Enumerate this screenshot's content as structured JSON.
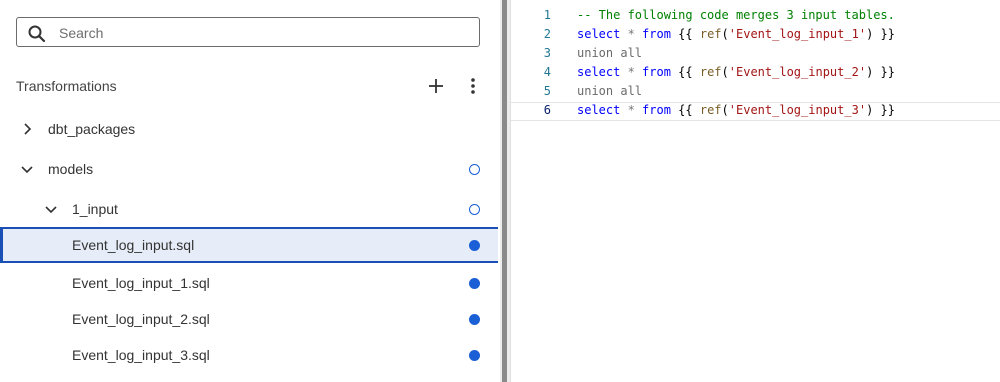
{
  "sidebar": {
    "search": {
      "placeholder": "Search"
    },
    "section_title": "Transformations",
    "add_icon": "plus-icon",
    "more_icon": "vertical-ellipsis-icon",
    "tree": [
      {
        "label": "dbt_packages",
        "expander": "chevron-right",
        "status": "none",
        "selected": false
      },
      {
        "label": "models",
        "expander": "chevron-down",
        "status": "open-circle",
        "selected": false
      },
      {
        "label": "1_input",
        "expander": "chevron-down",
        "status": "open-circle",
        "selected": false
      },
      {
        "label": "Event_log_input.sql",
        "expander": "none",
        "status": "filled-circle",
        "selected": true
      },
      {
        "label": "Event_log_input_1.sql",
        "expander": "none",
        "status": "filled-circle",
        "selected": false
      },
      {
        "label": "Event_log_input_2.sql",
        "expander": "none",
        "status": "filled-circle",
        "selected": false
      },
      {
        "label": "Event_log_input_3.sql",
        "expander": "none",
        "status": "filled-circle",
        "selected": false
      }
    ]
  },
  "editor": {
    "current_line": 6,
    "lines": [
      {
        "num": "1",
        "tokens": [
          {
            "t": "-- The following code merges 3 input tables.",
            "c": "comment"
          }
        ]
      },
      {
        "num": "2",
        "tokens": [
          {
            "t": "select",
            "c": "keyword"
          },
          {
            "t": " * ",
            "c": "op"
          },
          {
            "t": "from",
            "c": "keyword"
          },
          {
            "t": " {{ ",
            "c": "punct"
          },
          {
            "t": "ref",
            "c": "fn"
          },
          {
            "t": "(",
            "c": "punct"
          },
          {
            "t": "'Event_log_input_1'",
            "c": "string"
          },
          {
            "t": ") }}",
            "c": "punct"
          }
        ]
      },
      {
        "num": "3",
        "tokens": [
          {
            "t": "union all",
            "c": "plain"
          }
        ]
      },
      {
        "num": "4",
        "tokens": [
          {
            "t": "select",
            "c": "keyword"
          },
          {
            "t": " * ",
            "c": "op"
          },
          {
            "t": "from",
            "c": "keyword"
          },
          {
            "t": " {{ ",
            "c": "punct"
          },
          {
            "t": "ref",
            "c": "fn"
          },
          {
            "t": "(",
            "c": "punct"
          },
          {
            "t": "'Event_log_input_2'",
            "c": "string"
          },
          {
            "t": ") }}",
            "c": "punct"
          }
        ]
      },
      {
        "num": "5",
        "tokens": [
          {
            "t": "union all",
            "c": "plain"
          }
        ]
      },
      {
        "num": "6",
        "tokens": [
          {
            "t": "select",
            "c": "keyword"
          },
          {
            "t": " * ",
            "c": "op"
          },
          {
            "t": "from",
            "c": "keyword"
          },
          {
            "t": " {{ ",
            "c": "punct"
          },
          {
            "t": "ref",
            "c": "fn"
          },
          {
            "t": "(",
            "c": "punct"
          },
          {
            "t": "'Event_log_input_3'",
            "c": "string"
          },
          {
            "t": ") }}",
            "c": "punct"
          }
        ]
      }
    ]
  },
  "colors": {
    "accent": "#1a5fd6",
    "selected_bg": "#e6edf8",
    "selected_border": "#1a4fb5",
    "comment": "#008000",
    "keyword": "#0000ff",
    "string": "#a31515",
    "function": "#795e26"
  }
}
